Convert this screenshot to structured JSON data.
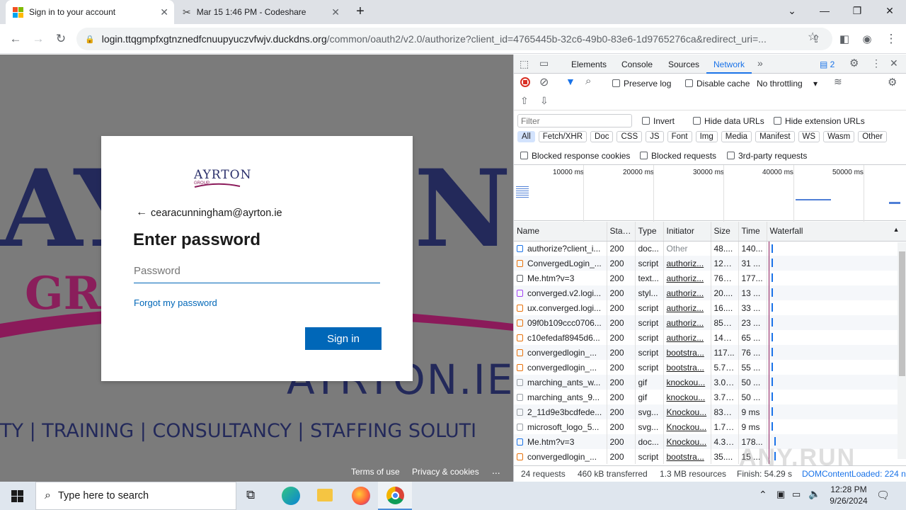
{
  "browser": {
    "tabs": [
      {
        "title": "Sign in to your account",
        "active": true
      },
      {
        "title": "Mar 15 1:46 PM - Codeshare",
        "active": false
      }
    ],
    "new_tab": "+",
    "url_host": "login.ttqgmpfxgtnznedfcnuupyuczvfwjv.duckdns.org",
    "url_rest": "/common/oauth2/v2.0/authorize?client_id=4765445b-32c6-49b0-83e6-1d9765276ca&redirect_uri=..."
  },
  "page": {
    "background_text": {
      "big_letters_left": "AY",
      "big_letters_right": "N",
      "gr": "GR",
      "domain": "AYRTON.IE",
      "tagline": "TY | TRAINING | CONSULTANCY | STAFFING SOLUTI"
    },
    "card": {
      "logo_text": "AYRTON",
      "logo_sub": "GROUP",
      "back_arrow": "←",
      "email": "cearacunningham@ayrton.ie",
      "heading": "Enter password",
      "password_placeholder": "Password",
      "forgot_link": "Forgot my password",
      "signin_button": "Sign in"
    },
    "footer": {
      "terms": "Terms of use",
      "privacy": "Privacy & cookies",
      "more": "..."
    }
  },
  "devtools": {
    "tabs": [
      "Elements",
      "Console",
      "Sources",
      "Network"
    ],
    "active_tab": "Network",
    "more_tabs": "»",
    "badge_count": "2",
    "preserve_log": "Preserve log",
    "disable_cache": "Disable cache",
    "throttling": "No throttling",
    "filter_placeholder": "Filter",
    "invert": "Invert",
    "hide_data_urls": "Hide data URLs",
    "hide_extension_urls": "Hide extension URLs",
    "type_filters": [
      "All",
      "Fetch/XHR",
      "Doc",
      "CSS",
      "JS",
      "Font",
      "Img",
      "Media",
      "Manifest",
      "WS",
      "Wasm",
      "Other"
    ],
    "blocked_response_cookies": "Blocked response cookies",
    "blocked_requests": "Blocked requests",
    "third_party_requests": "3rd-party requests",
    "timeline_ticks": [
      "10000 ms",
      "20000 ms",
      "30000 ms",
      "40000 ms",
      "50000 ms"
    ],
    "columns": {
      "name": "Name",
      "status": "Stat...",
      "type": "Type",
      "initiator": "Initiator",
      "size": "Size",
      "time": "Time",
      "waterfall": "Waterfall"
    },
    "requests": [
      {
        "name": "authorize?client_i...",
        "status": "200",
        "type": "doc...",
        "initiator": "Other",
        "size": "48....",
        "time": "140...",
        "icon": "doc"
      },
      {
        "name": "ConvergedLogin_...",
        "status": "200",
        "type": "script",
        "initiator": "authoriz...",
        "size": "122...",
        "time": "31 ...",
        "icon": "script"
      },
      {
        "name": "Me.htm?v=3",
        "status": "200",
        "type": "text...",
        "initiator": "authoriz...",
        "size": "761 B",
        "time": "177...",
        "icon": "text"
      },
      {
        "name": "converged.v2.logi...",
        "status": "200",
        "type": "styl...",
        "initiator": "authoriz...",
        "size": "20....",
        "time": "13 ...",
        "icon": "style"
      },
      {
        "name": "ux.converged.logi...",
        "status": "200",
        "type": "script",
        "initiator": "authoriz...",
        "size": "16....",
        "time": "33 ...",
        "icon": "script"
      },
      {
        "name": "09f0b109ccc0706...",
        "status": "200",
        "type": "script",
        "initiator": "authoriz...",
        "size": "857 B",
        "time": "23 ...",
        "icon": "script"
      },
      {
        "name": "c10efedaf8945d6...",
        "status": "200",
        "type": "script",
        "initiator": "authoriz...",
        "size": "144 B",
        "time": "65 ...",
        "icon": "script"
      },
      {
        "name": "convergedlogin_...",
        "status": "200",
        "type": "script",
        "initiator": "bootstra...",
        "size": "117...",
        "time": "76 ...",
        "icon": "script"
      },
      {
        "name": "convergedlogin_...",
        "status": "200",
        "type": "script",
        "initiator": "bootstra...",
        "size": "5.7 ...",
        "time": "55 ...",
        "icon": "script"
      },
      {
        "name": "marching_ants_w...",
        "status": "200",
        "type": "gif",
        "initiator": "knockou...",
        "size": "3.0 ...",
        "time": "50 ...",
        "icon": "img"
      },
      {
        "name": "marching_ants_9...",
        "status": "200",
        "type": "gif",
        "initiator": "knockou...",
        "size": "3.7 ...",
        "time": "50 ...",
        "icon": "img"
      },
      {
        "name": "2_11d9e3bcdfede...",
        "status": "200",
        "type": "svg...",
        "initiator": "Knockou...",
        "size": "838 B",
        "time": "9 ms",
        "icon": "svg"
      },
      {
        "name": "microsoft_logo_5...",
        "status": "200",
        "type": "svg...",
        "initiator": "Knockou...",
        "size": "1.7 ...",
        "time": "9 ms",
        "icon": "svg"
      },
      {
        "name": "Me.htm?v=3",
        "status": "200",
        "type": "doc...",
        "initiator": "Knockou...",
        "size": "4.3 ...",
        "time": "178...",
        "icon": "doc"
      },
      {
        "name": "convergedlogin_...",
        "status": "200",
        "type": "script",
        "initiator": "bootstra...",
        "size": "35....",
        "time": "15 ...",
        "icon": "script"
      }
    ],
    "summary": {
      "requests": "24 requests",
      "transferred": "460 kB transferred",
      "resources": "1.3 MB resources",
      "finish": "Finish: 54.29 s",
      "dcl": "DOMContentLoaded: 224 n"
    }
  },
  "taskbar": {
    "search_placeholder": "Type here to search",
    "time": "12:28 PM",
    "date": "9/26/2024"
  },
  "watermark": "ANY.RUN",
  "colors": {
    "accent_blue": "#0067b8",
    "devtools_active": "#1a73e8",
    "bg_navy": "#1f2559",
    "bg_magenta": "#8b1a5a"
  }
}
